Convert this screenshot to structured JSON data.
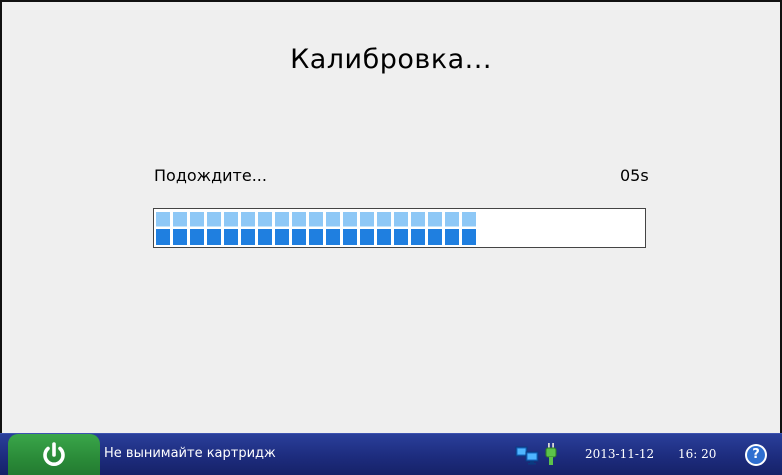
{
  "dialog": {
    "title": "Калибровка...",
    "wait_label": "Подождите...",
    "timer": "05s",
    "progress_segments_filled": 19,
    "progress_fraction": 0.64
  },
  "statusbar": {
    "power_icon": "power-icon",
    "message": "Не вынимайте картридж",
    "network_icon": "network-icon",
    "plug_icon": "plug-icon",
    "date": "2013-11-12",
    "time": "16: 20",
    "help_icon": "help-icon",
    "help_glyph": "?"
  },
  "colors": {
    "background": "#efefef",
    "statusbar": "#1d2c7e",
    "power_button": "#2a8a38",
    "progress_light": "#8ec8f6",
    "progress_dark": "#1f7fe0"
  }
}
